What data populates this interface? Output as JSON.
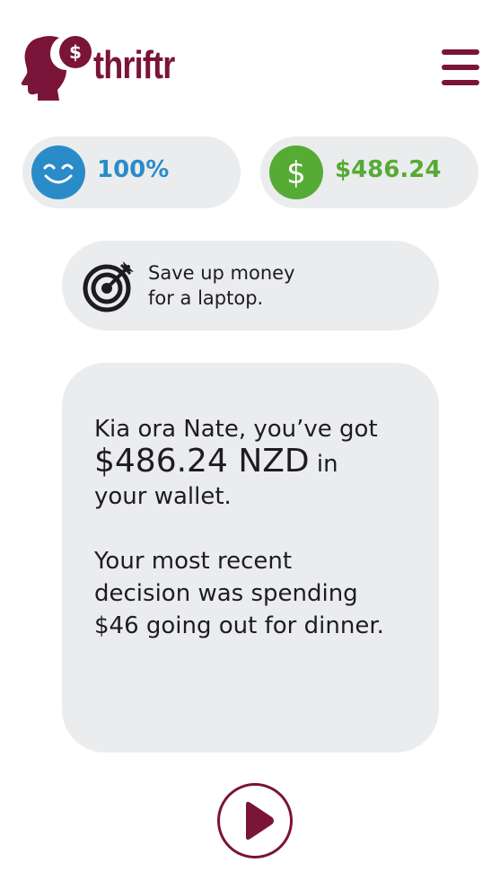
{
  "header": {
    "brand": "thriftr",
    "logo_icon": "head-with-dollar-icon",
    "menu_icon": "hamburger-menu-icon"
  },
  "stats": {
    "mood": {
      "value": "100%",
      "icon": "smiley-face-icon",
      "color": "#2a8bc9"
    },
    "balance": {
      "value": "$486.24",
      "icon": "dollar-coin-icon",
      "color": "#56ab35"
    }
  },
  "goal": {
    "icon": "target-dart-icon",
    "line1": "Save up money",
    "line2": "for a laptop."
  },
  "message": {
    "line1": "Kia ora Nate, you’ve got",
    "amount": "$486.24 NZD",
    "after_amount": " in",
    "line3": "your wallet.",
    "recent_line1": "Your most recent",
    "recent_line2": "decision was spending",
    "recent_line3": "$46 going out for dinner."
  },
  "controls": {
    "play_icon": "play-icon"
  },
  "colors": {
    "brand": "#7a1438",
    "card": "#ebecee"
  }
}
